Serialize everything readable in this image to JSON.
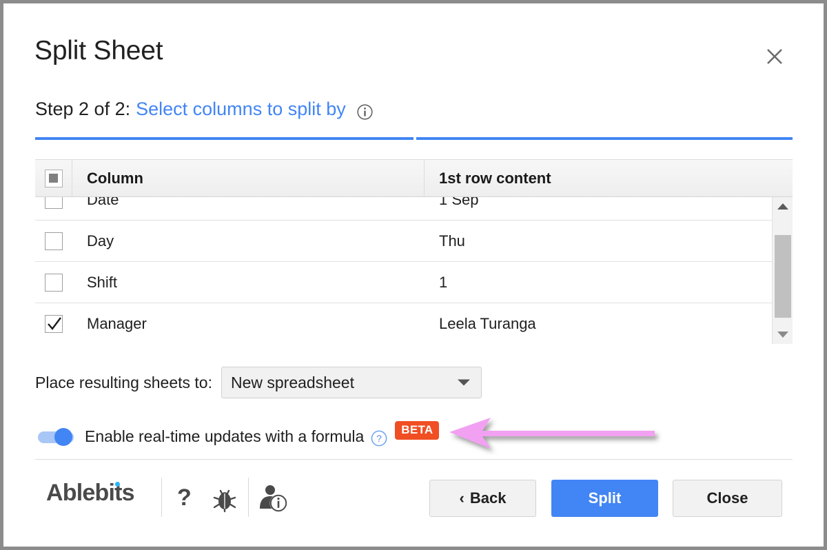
{
  "dialog": {
    "title": "Split Sheet",
    "close_icon": "close-icon"
  },
  "step": {
    "prefix": "Step 2 of 2:",
    "link": "Select columns to split by",
    "info_icon": "info-icon",
    "progress_segments": 2,
    "progress_color": "#4285f4"
  },
  "table": {
    "headers": {
      "select_all": "select-all-checkbox",
      "column": "Column",
      "content": "1st row content"
    },
    "rows": [
      {
        "checked": false,
        "column": "Date",
        "content": "1 Sep"
      },
      {
        "checked": false,
        "column": "Day",
        "content": "Thu"
      },
      {
        "checked": false,
        "column": "Shift",
        "content": "1"
      },
      {
        "checked": true,
        "column": "Manager",
        "content": "Leela Turanga"
      }
    ],
    "scrollbar": {
      "up_icon": "scroll-up-arrow-icon",
      "down_icon": "scroll-down-arrow-icon"
    }
  },
  "place": {
    "label": "Place resulting sheets to:",
    "selected": "New spreadsheet",
    "caret_icon": "chevron-down-icon"
  },
  "toggle": {
    "state": "on",
    "label": "Enable real-time updates with a formula",
    "help_icon": "question-mark-icon",
    "badge": "BETA",
    "badge_color": "#f04e23",
    "accent_color": "#4285f4"
  },
  "annotation": {
    "arrow_color": "#f2a0f2",
    "direction": "left"
  },
  "footer": {
    "brand": "Ablebits",
    "brand_dot_color": "#29b6f6",
    "icons": [
      {
        "name": "help-icon",
        "glyph": "?"
      },
      {
        "name": "bug-icon",
        "glyph": "bug"
      },
      {
        "name": "account-info-icon",
        "glyph": "person-info"
      }
    ],
    "buttons": {
      "back": "Back",
      "back_chevron": "‹",
      "split": "Split",
      "close": "Close"
    }
  }
}
